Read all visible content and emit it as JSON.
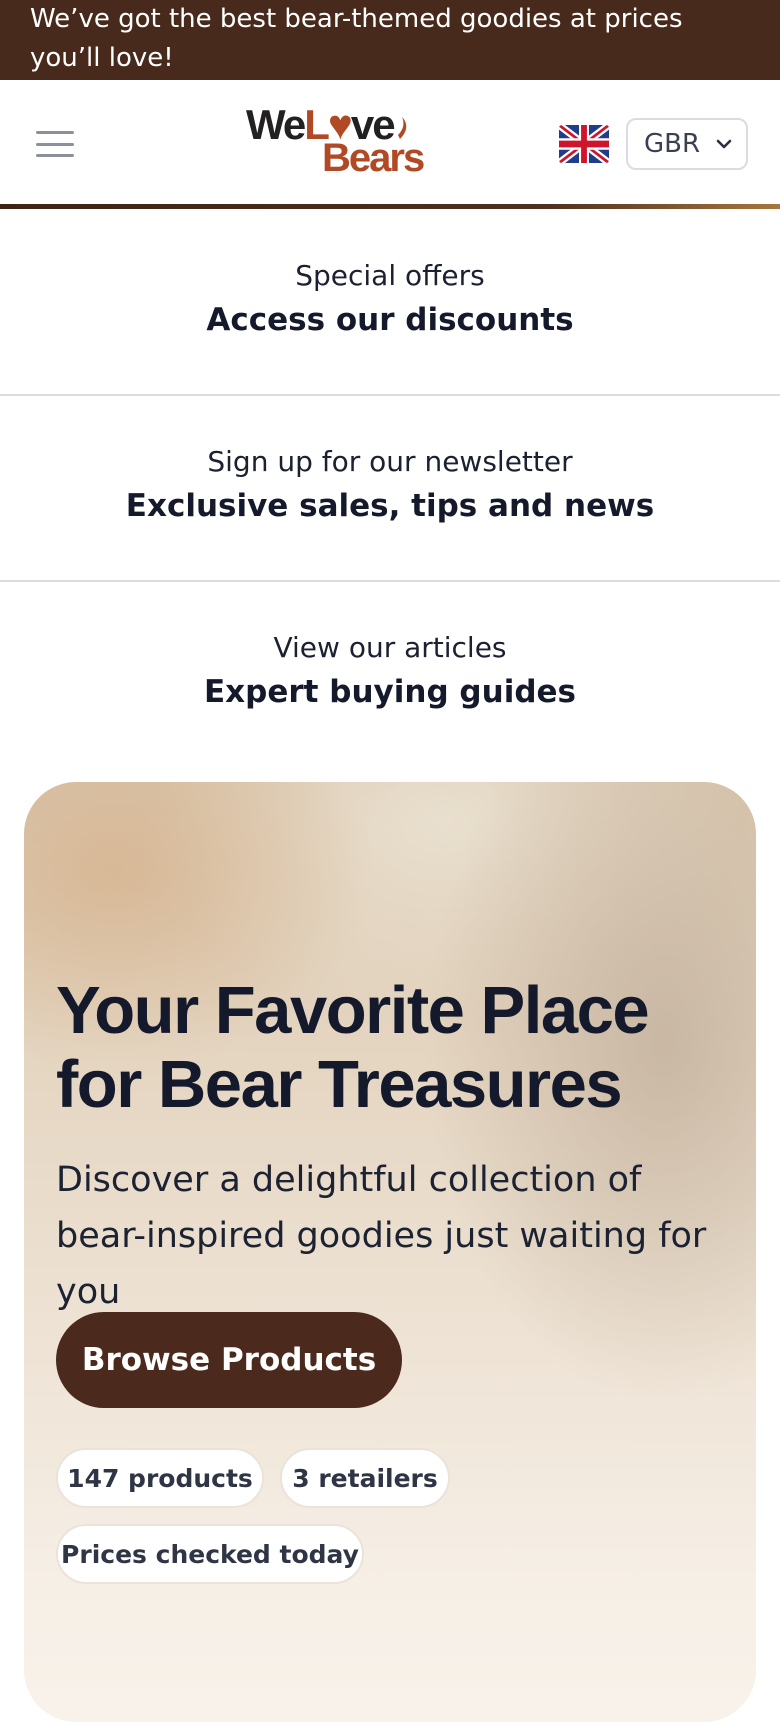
{
  "announcement": {
    "text": "We’ve got the best bear-themed goodies at prices you’ll love!"
  },
  "header": {
    "menu_icon": "hamburger-menu-icon",
    "logo": {
      "line1_a": "We",
      "line1_b": "L",
      "line1_c": "ve",
      "line2": "Bears",
      "brand_dark": "#222021",
      "brand_rust": "#b14a24"
    },
    "flag_icon": "uk-flag-icon",
    "currency": {
      "value": "GBR",
      "icon": "chevron-down-icon"
    }
  },
  "promos": [
    {
      "small": "Special offers",
      "big": "Access our discounts"
    },
    {
      "small": "Sign up for our newsletter",
      "big": "Exclusive sales, tips and news"
    },
    {
      "small": "View our articles",
      "big": "Expert buying guides"
    }
  ],
  "hero": {
    "title": "Your Favorite Place for Bear Treasures",
    "subtitle": "Discover a delightful collection of bear-inspired goodies just waiting for you",
    "cta_label": "Browse Products",
    "chips": [
      "147 products",
      "3 retailers",
      "Prices checked today"
    ]
  },
  "colors": {
    "announcement_bg": "#482a1c",
    "cta_bg": "#4b2a1d",
    "text_dark": "#141a2b"
  }
}
